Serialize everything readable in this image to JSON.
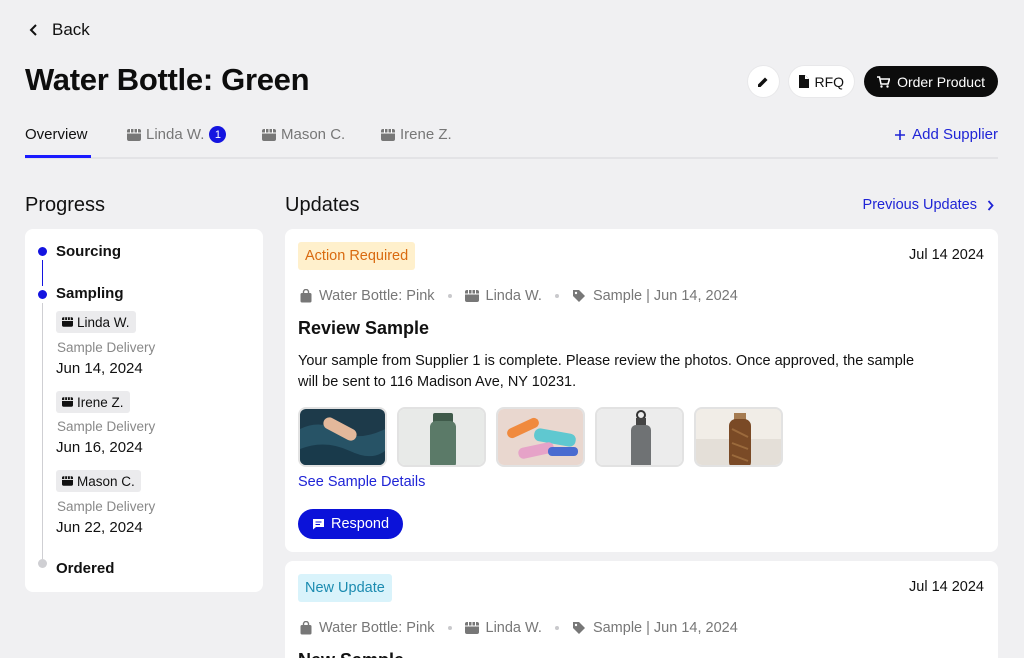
{
  "header": {
    "back_label": "Back",
    "title": "Water Bottle: Green",
    "rfq_label": "RFQ",
    "order_label": "Order Product"
  },
  "tabs": [
    {
      "label": "Overview"
    },
    {
      "label": "Linda W.",
      "badge": "1"
    },
    {
      "label": "Mason C."
    },
    {
      "label": "Irene Z."
    }
  ],
  "add_supplier_label": "Add Supplier",
  "progress": {
    "heading": "Progress",
    "stages": [
      "Sourcing",
      "Sampling",
      "Ordered"
    ],
    "suppliers": [
      {
        "name": "Linda W.",
        "label": "Sample Delivery",
        "date": "Jun 14, 2024"
      },
      {
        "name": "Irene Z.",
        "label": "Sample Delivery",
        "date": "Jun 16, 2024"
      },
      {
        "name": "Mason C.",
        "label": "Sample Delivery",
        "date": "Jun 22, 2024"
      }
    ]
  },
  "updates": {
    "heading": "Updates",
    "previous_label": "Previous Updates",
    "cards": [
      {
        "tag": "Action Required",
        "date": "Jul 14 2024",
        "product": "Water Bottle: Pink",
        "supplier": "Linda W.",
        "sample": "Sample | Jun 14, 2024",
        "title": "Review Sample",
        "body": "Your sample from Supplier 1 is complete. Please review the photos. Once approved, the sample will be sent to 116 Madison Ave, NY 10231.",
        "details_link": "See Sample Details",
        "respond_label": "Respond"
      },
      {
        "tag": "New Update",
        "date": "Jul 14 2024",
        "product": "Water Bottle: Pink",
        "supplier": "Linda W.",
        "sample": "Sample | Jun 14, 2024",
        "title": "New Sample"
      }
    ]
  },
  "colors": {
    "accent": "#1f24d6",
    "warn_bg": "#fff0cc",
    "warn_text": "#d96a10",
    "info_bg": "#d9f3fb",
    "info_text": "#1b8bb0"
  }
}
